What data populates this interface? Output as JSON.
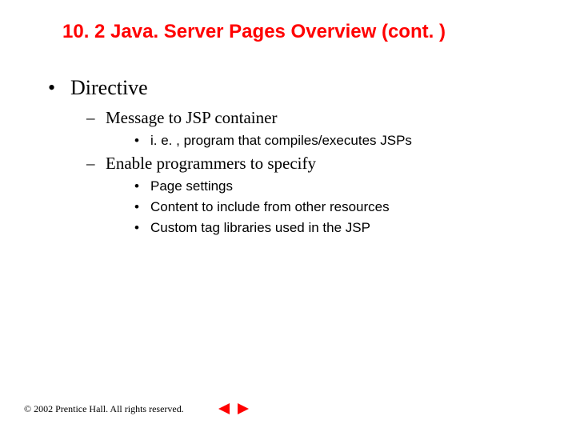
{
  "title": "10. 2   Java. Server Pages Overview (cont. )",
  "outline": {
    "item1": {
      "label": "Directive",
      "sub1": {
        "label": "Message to JSP container",
        "detail1": "i. e. , program that compiles/executes JSPs"
      },
      "sub2": {
        "label": "Enable programmers to specify",
        "detail1": "Page settings",
        "detail2": "Content to include from other resources",
        "detail3": "Custom tag libraries used in the JSP"
      }
    }
  },
  "footer": {
    "copyright": "© 2002 Prentice Hall. All rights reserved."
  },
  "colors": {
    "title": "#ff0000",
    "nav": "#ff0000"
  }
}
